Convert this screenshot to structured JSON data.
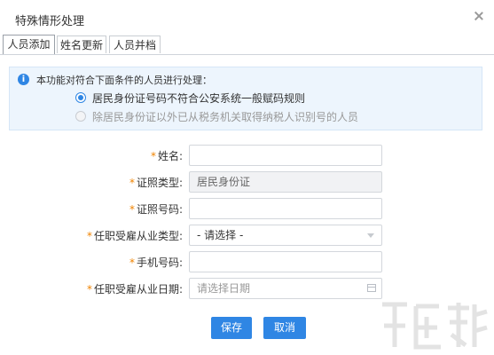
{
  "dialog": {
    "title": "特殊情形处理"
  },
  "tabs": [
    {
      "label": "人员添加",
      "active": true
    },
    {
      "label": "姓名更新",
      "active": false
    },
    {
      "label": "人员并档",
      "active": false
    }
  ],
  "info": {
    "text": "本功能对符合下面条件的人员进行处理：",
    "options": [
      {
        "label": "居民身份证号码不符合公安系统一般赋码规则",
        "selected": true,
        "disabled": false
      },
      {
        "label": "除居民身份证以外已从税务机关取得纳税人识别号的人员",
        "selected": false,
        "disabled": true
      }
    ]
  },
  "form": {
    "name": {
      "label": "姓名:",
      "value": ""
    },
    "id_type": {
      "label": "证照类型:",
      "value": "居民身份证"
    },
    "id_number": {
      "label": "证照号码:",
      "value": ""
    },
    "employment_type": {
      "label": "任职受雇从业类型:",
      "value": "- 请选择 -"
    },
    "phone": {
      "label": "手机号码:",
      "value": ""
    },
    "employment_date": {
      "label": "任职受雇从业日期:",
      "placeholder": "请选择日期"
    }
  },
  "buttons": {
    "save": "保存",
    "cancel": "取消"
  },
  "colors": {
    "accent": "#2f86e4",
    "required": "#f08300"
  },
  "icons": {
    "info": "info-icon",
    "close": "close-icon",
    "calendar": "calendar-icon",
    "dropdown": "chevron-down-icon"
  }
}
